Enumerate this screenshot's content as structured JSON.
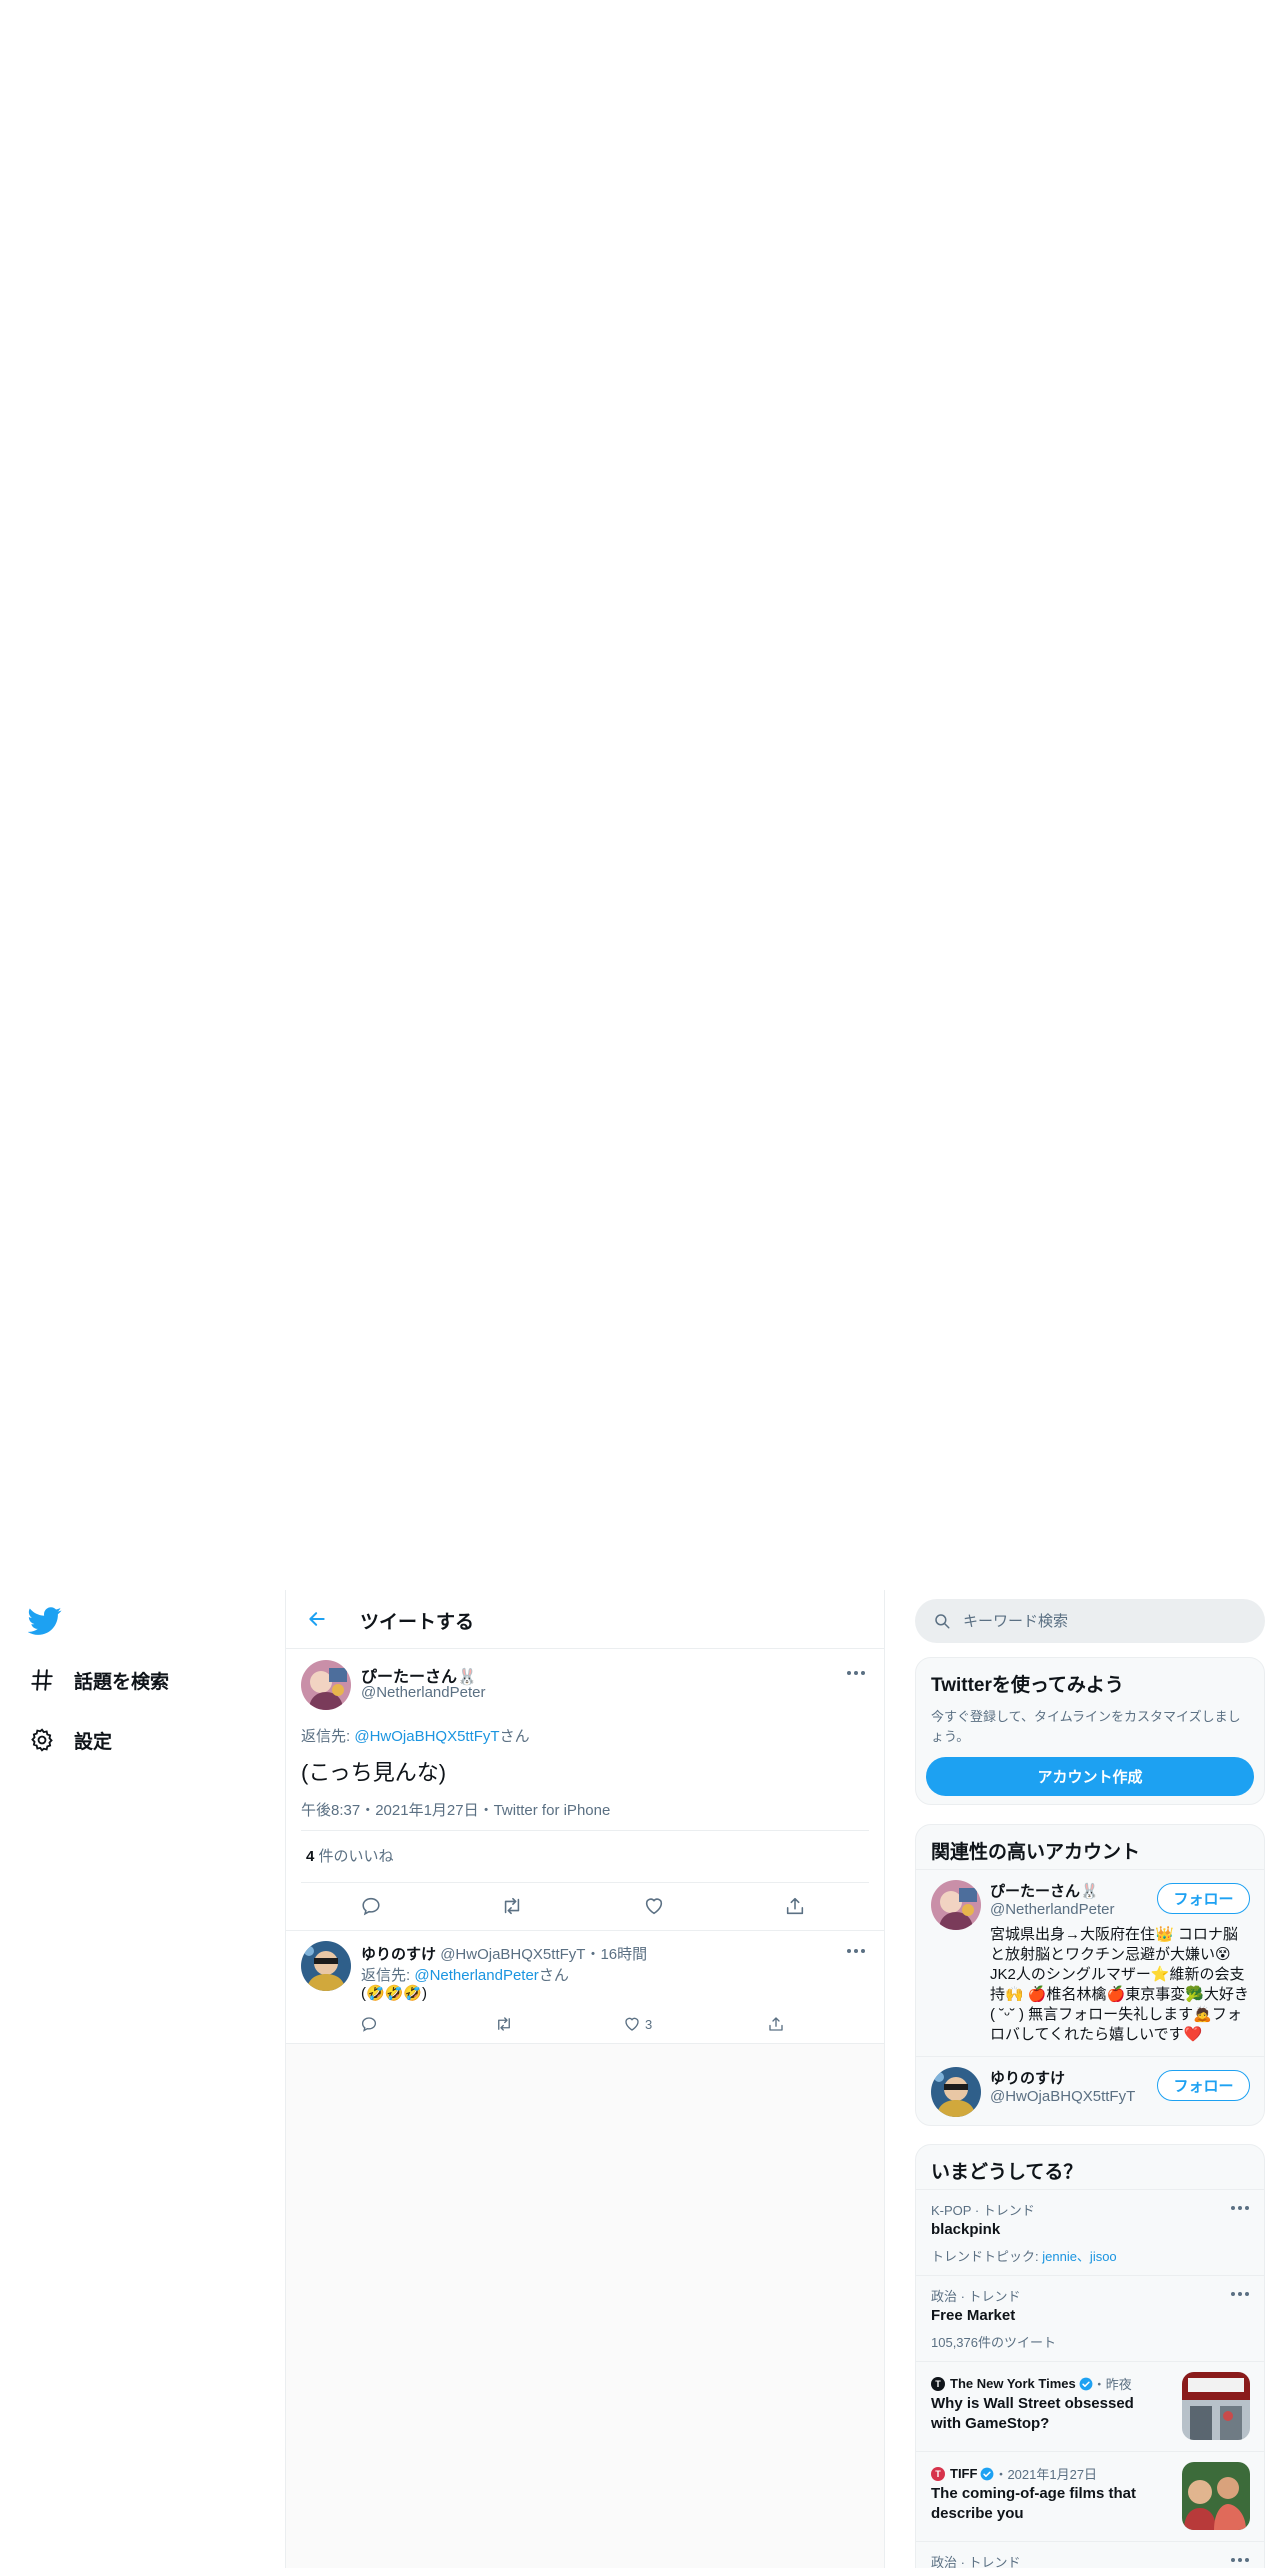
{
  "nav": {
    "items": [
      {
        "label": "話題を検索",
        "icon": "hashtag-icon"
      },
      {
        "label": "設定",
        "icon": "gear-icon"
      }
    ]
  },
  "main": {
    "header_title": "ツイートする",
    "tweet": {
      "name": "ぴーたーさん🐰",
      "handle": "@NetherlandPeter",
      "reply_prefix": "返信先: ",
      "reply_to": "@HwOjaBHQX5ttFyT",
      "reply_suffix": "さん",
      "text": "(こっち見んな)",
      "meta": "午後8:37・2021年1月27日・Twitter for iPhone",
      "likes_count": "4",
      "likes_label": " 件のいいね"
    },
    "reply": {
      "name": "ゆりのすけ",
      "handle": "@HwOjaBHQX5ttFyT",
      "time": "・16時間",
      "reply_prefix": "返信先: ",
      "reply_to": "@NetherlandPeter",
      "reply_suffix": "さん",
      "text": "(🤣🤣🤣)",
      "like_count": "3"
    }
  },
  "sidebar": {
    "search_placeholder": "キーワード検索",
    "signup": {
      "title": "Twitterを使ってみよう",
      "desc": "今すぐ登録して、タイムラインをカスタマイズしましょう。",
      "button": "アカウント作成"
    },
    "related": {
      "title": "関連性の高いアカウント",
      "accounts": [
        {
          "name": "ぴーたーさん🐰",
          "handle": "@NetherlandPeter",
          "bio": "宮城県出身→大阪府在住👑 コロナ脳と放射脳とワクチン忌避が大嫌い😵JK2人のシングルマザー⭐維新の会支持🙌 🍎椎名林檎🍎東京事変🥦大好き( ˘ᵕ˘ ) 無言フォロー失礼します🙇フォロバしてくれたら嬉しいです❤️",
          "follow": "フォロー"
        },
        {
          "name": "ゆりのすけ",
          "handle": "@HwOjaBHQX5ttFyT",
          "follow": "フォロー"
        }
      ]
    },
    "trends": {
      "title": "いまどうしてる？",
      "items": [
        {
          "category": "K-POP · トレンド",
          "title": "blackpink",
          "sub_prefix": "トレンドトピック: ",
          "sub_links": "jennie、jisoo"
        },
        {
          "category": "政治 · トレンド",
          "title": "Free Market",
          "sub": "105,376件のツイート"
        },
        {
          "source": "The New York Times",
          "when": "・昨夜",
          "title": "Why is Wall Street obsessed with GameStop?"
        },
        {
          "source": "TIFF",
          "when": "・2021年1月27日",
          "title": "The coming-of-age films that describe you"
        },
        {
          "category": "政治 · トレンド"
        }
      ]
    }
  },
  "colors": {
    "accent": "#1da1f2",
    "link": "#1b95e0",
    "muted": "#5b7083",
    "text": "#0f1419",
    "border": "#ebeef0"
  }
}
